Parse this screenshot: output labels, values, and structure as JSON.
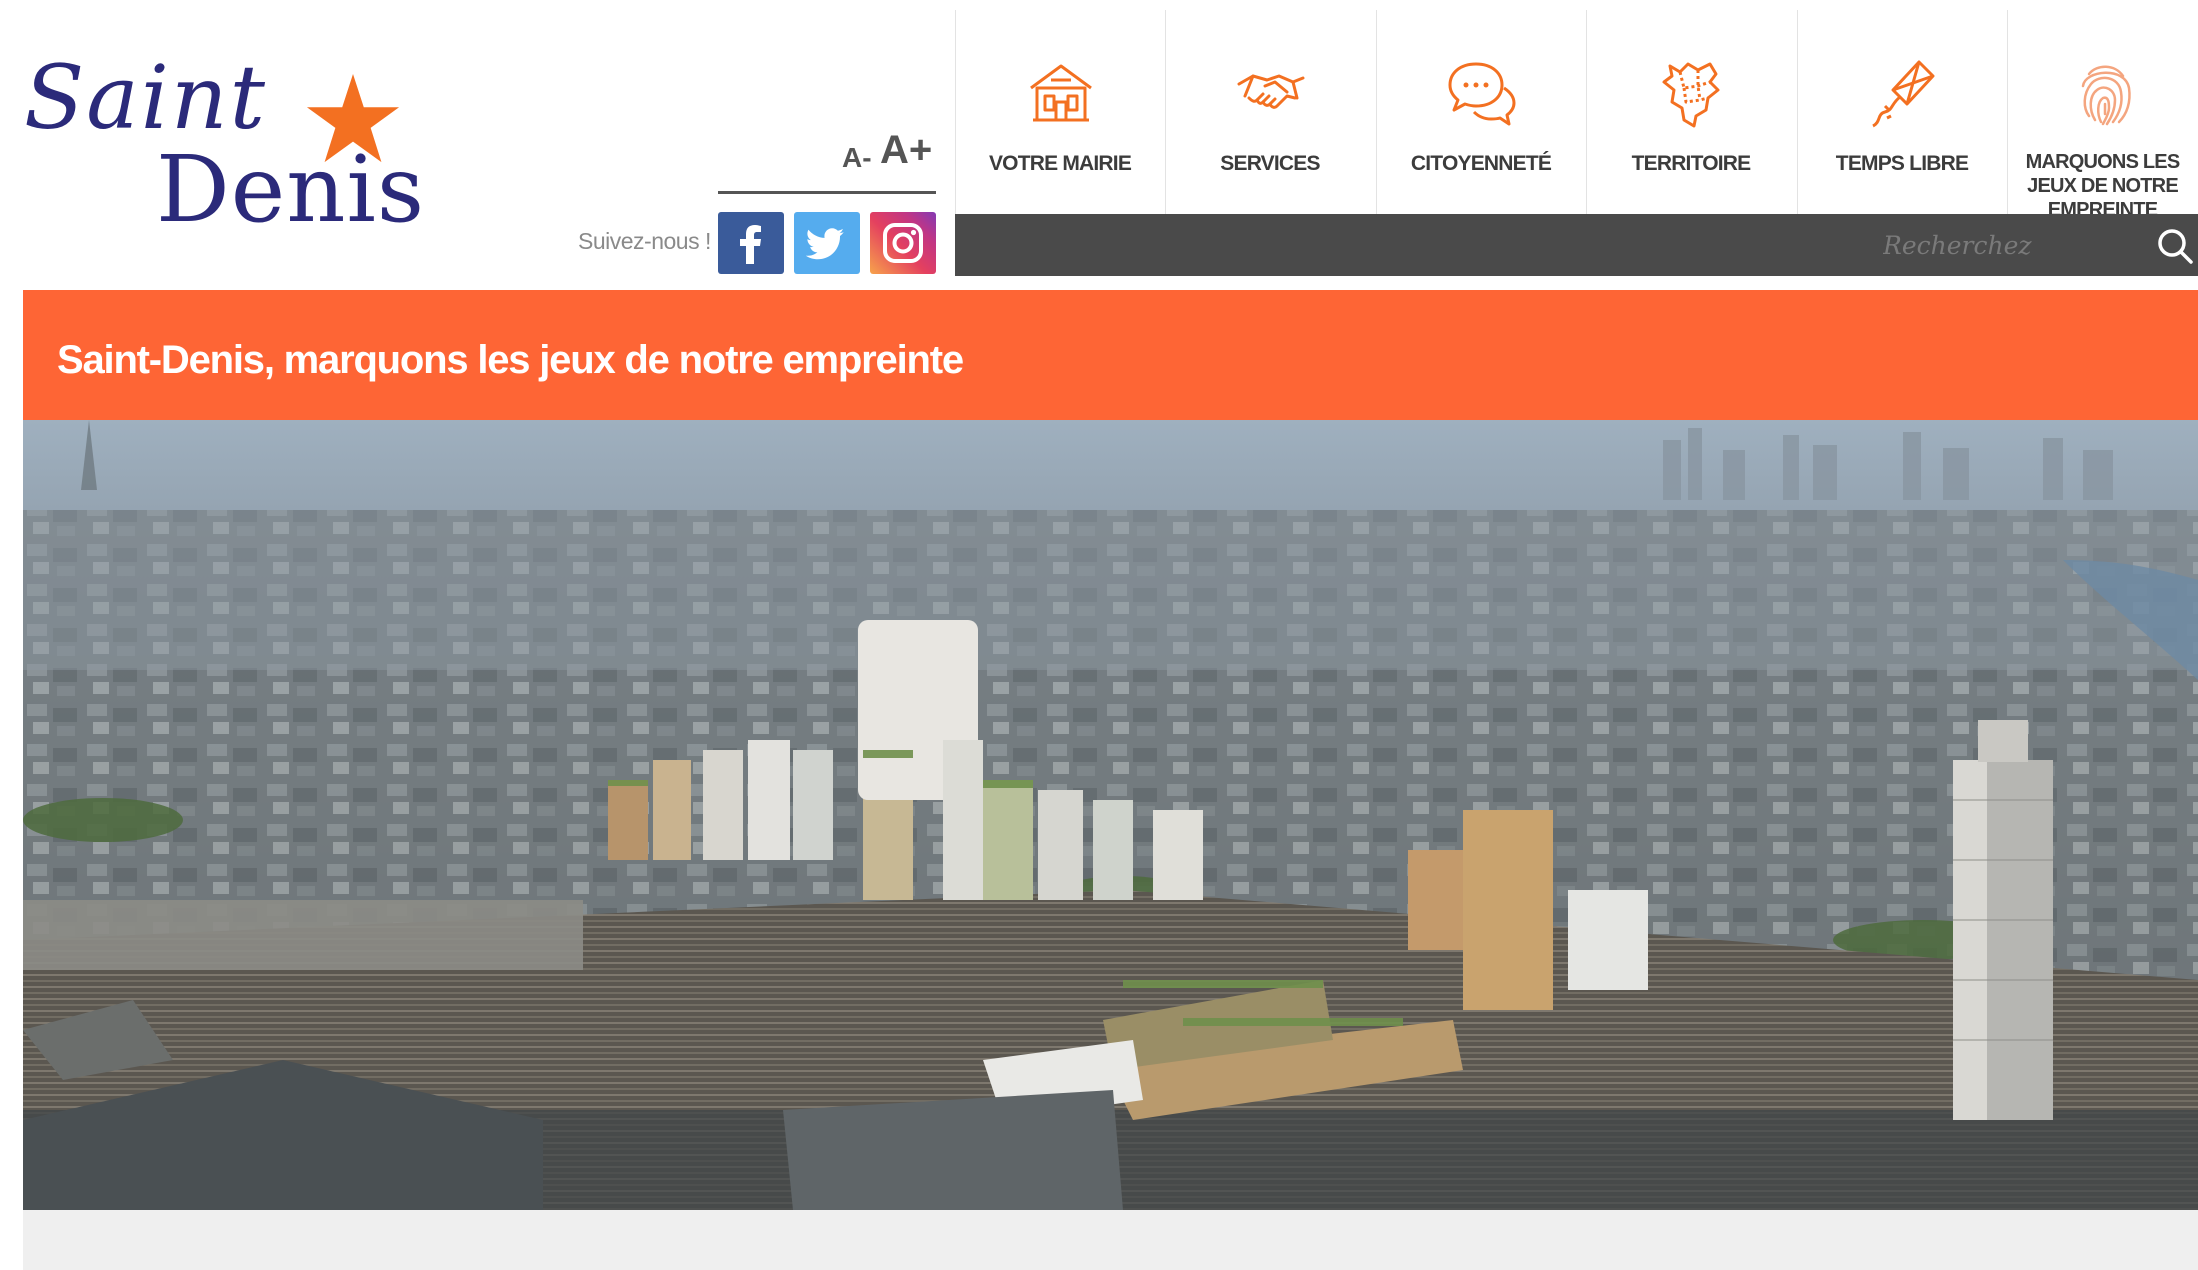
{
  "logo": {
    "line1": "Saint",
    "line2": "Denis",
    "star_color": "#f37021",
    "text_color": "#2b2a7a"
  },
  "font_controls": {
    "decrease": "A-",
    "increase": "A+"
  },
  "social": {
    "label": "Suivez-nous !",
    "links": [
      {
        "name": "facebook",
        "icon": "facebook-icon",
        "color": "#3a5b9a"
      },
      {
        "name": "twitter",
        "icon": "twitter-icon",
        "color": "#55acee"
      },
      {
        "name": "instagram",
        "icon": "instagram-icon",
        "color": "#e4405f"
      }
    ]
  },
  "nav": {
    "items": [
      {
        "label": "VOTRE MAIRIE",
        "icon": "town-hall-icon"
      },
      {
        "label": "SERVICES",
        "icon": "handshake-icon"
      },
      {
        "label": "CITOYENNETÉ",
        "icon": "speech-bubbles-icon"
      },
      {
        "label": "TERRITOIRE",
        "icon": "map-icon"
      },
      {
        "label": "TEMPS LIBRE",
        "icon": "kite-icon"
      },
      {
        "label": "MARQUONS LES JEUX DE NOTRE EMPREINTE",
        "icon": "fingerprint-icon"
      }
    ],
    "accent": "#f37021"
  },
  "search": {
    "placeholder": "Recherchez",
    "icon": "search-icon"
  },
  "banner": {
    "title": "Saint-Denis, marquons les jeux de notre empreinte",
    "color": "#fe6535"
  },
  "hero": {
    "alt": "aerial-city-view"
  }
}
